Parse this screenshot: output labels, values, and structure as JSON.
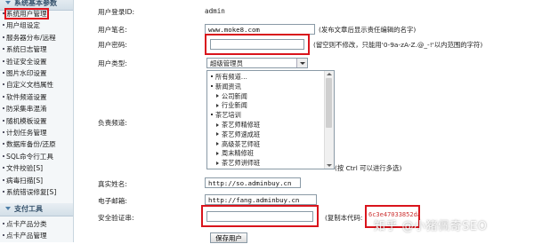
{
  "sidebar": {
    "section1_title": "系统基本参数",
    "items": [
      {
        "label": "系统用户管理"
      },
      {
        "label": "用户组设定"
      },
      {
        "label": "服务器分布/远程"
      },
      {
        "label": "系统日志管理"
      },
      {
        "label": "验证安全设置"
      },
      {
        "label": "图片水印设置"
      },
      {
        "label": "自定义文档属性"
      },
      {
        "label": "软件频道设置"
      },
      {
        "label": "防采集串混淆"
      },
      {
        "label": "随机模板设置"
      },
      {
        "label": "计划任务管理"
      },
      {
        "label": "数据库备份/还原"
      },
      {
        "label": "SQL命令行工具"
      },
      {
        "label": "文件校验[S]"
      },
      {
        "label": "病毒扫描[S]"
      },
      {
        "label": "系统错误修复[S]"
      }
    ],
    "section2_title": "支付工具",
    "items2": [
      {
        "label": "点卡产品分类"
      },
      {
        "label": "点卡产品管理"
      }
    ]
  },
  "form": {
    "login_id_label": "用户登录ID:",
    "login_id_value": "admin",
    "username_label": "用户笔名:",
    "username_value": "www.moke8.com",
    "username_hint": "(发布文章后显示责任编辑的名字)",
    "password_label": "用户密码:",
    "password_value": "",
    "password_hint": "(留空则不修改，只能用'0-9a-zA-Z.@_-!'以内范围的字符)",
    "usertype_label": "用户类型:",
    "usertype_value": "超级管理员",
    "channels_label": "负责频道:",
    "channels_hint": "(按 Ctrl 可以进行多选)",
    "channels": [
      {
        "label": "所有频道…",
        "level": 0
      },
      {
        "label": "新闻资讯",
        "level": 0
      },
      {
        "label": "公司新闻",
        "level": 1
      },
      {
        "label": "行业新闻",
        "level": 1
      },
      {
        "label": "茶艺培训",
        "level": 0
      },
      {
        "label": "茶艺师精修班",
        "level": 1
      },
      {
        "label": "茶艺师速成班",
        "level": 1
      },
      {
        "label": "高级茶艺师班",
        "level": 1
      },
      {
        "label": "周末精修班",
        "level": 1
      },
      {
        "label": "茶艺师讲师班",
        "level": 1
      }
    ],
    "realname_label": "真实姓名:",
    "realname_value": "http://so.adminbuy.cn",
    "email_label": "电子邮箱:",
    "email_value": "http://fang.adminbuy.cn",
    "safecode_label": "安全验证串:",
    "safecode_value": "",
    "copy_code_label": "(复制本代码:",
    "copy_code_value": "6c3e47033852da1ab8ef4854c7",
    "save_button": "保存用户"
  },
  "watermark": "知乎 @小猪佩奇SEO",
  "colors": {
    "highlight": "#d9141c",
    "sidebar_bg": "#f4f7f9"
  }
}
